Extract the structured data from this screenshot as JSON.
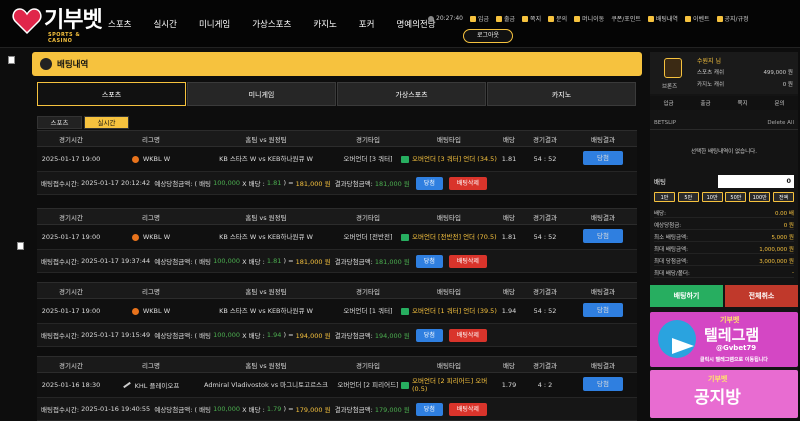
{
  "brand": {
    "name": "기부벳",
    "sub": "SPORTS & CASINO"
  },
  "nav": [
    "스포츠",
    "실시간",
    "미니게임",
    "가상스포츠",
    "카지노",
    "포커",
    "명예의전당"
  ],
  "topright": {
    "time": "20:27:40",
    "items": [
      "입금",
      "출금",
      "쪽지",
      "문의",
      "머니이동",
      "쿠폰/포인트",
      "배팅내역",
      "이벤트",
      "공지/규정"
    ]
  },
  "logout": "로그아웃",
  "page_title": "배팅내역",
  "tabs": [
    "스포츠",
    "미니게임",
    "가상스포츠",
    "카지노"
  ],
  "subtabs": [
    "스포츠",
    "실시간"
  ],
  "headers": [
    "경기시간",
    "리그명",
    "홈팀 vs 원정팀",
    "경기타입",
    "배팅타입",
    "배당",
    "경기결과",
    "배팅결과"
  ],
  "bets": [
    {
      "time": "2025-01-17 19:00",
      "league": "WKBL W",
      "icon": "basketball",
      "home": "KB 스타즈 W",
      "vs": "vs",
      "away": "KEB하나원큐 W",
      "type": "오버언더 [3 쿼터]",
      "pick": "오버언더 [3 쿼터] 언더 (34.5)",
      "odds": "1.81",
      "score": "54 : 52",
      "result": "당첨",
      "s_label": "배팅접수시간:",
      "s_time": "2025-01-17 20:12:42",
      "s_exp": "예상당첨금액: ( 배팅",
      "s_stake": "100,000",
      "s_x": "X 배당 :",
      "s_odds": "1.81",
      "s_eq": ") =",
      "s_win": "181,000 원",
      "s_res_label": "결과당첨금액:",
      "s_res": "181,000 원",
      "btn1": "당첨",
      "btn2": "배팅삭제"
    },
    {
      "time": "2025-01-17 19:00",
      "league": "WKBL W",
      "icon": "basketball",
      "home": "KB 스타즈 W",
      "vs": "vs",
      "away": "KEB하나원큐 W",
      "type": "오버언더 [전반전]",
      "pick": "오버언더 [전반전] 언더 (70.5)",
      "odds": "1.81",
      "score": "54 : 52",
      "result": "당첨",
      "s_label": "배팅접수시간:",
      "s_time": "2025-01-17 19:37:44",
      "s_exp": "예상당첨금액: ( 배팅",
      "s_stake": "100,000",
      "s_x": "X 배당 :",
      "s_odds": "1.81",
      "s_eq": ") =",
      "s_win": "181,000 원",
      "s_res_label": "결과당첨금액:",
      "s_res": "181,000 원",
      "btn1": "당첨",
      "btn2": "배팅삭제"
    },
    {
      "time": "2025-01-17 19:00",
      "league": "WKBL W",
      "icon": "basketball",
      "home": "KB 스타즈 W",
      "vs": "vs",
      "away": "KEB하나원큐 W",
      "type": "오버언더 [1 쿼터]",
      "pick": "오버언더 [1 쿼터] 언더 (39.5)",
      "odds": "1.94",
      "score": "54 : 52",
      "result": "당첨",
      "s_label": "배팅접수시간:",
      "s_time": "2025-01-17 19:15:49",
      "s_exp": "예상당첨금액: ( 배팅",
      "s_stake": "100,000",
      "s_x": "X 배당 :",
      "s_odds": "1.94",
      "s_eq": ") =",
      "s_win": "194,000 원",
      "s_res_label": "결과당첨금액:",
      "s_res": "194,000 원",
      "btn1": "당첨",
      "btn2": "배팅삭제"
    },
    {
      "time": "2025-01-16 18:30",
      "league": "KHL 플레이오프",
      "icon": "hockey",
      "home": "Admiral Vladivostok",
      "vs": "vs",
      "away": "마그니토고르스크",
      "type": "오버언더 [2 피리어드]",
      "pick": "오버언더 [2 피리어드] 오버 (0.5)",
      "odds": "1.79",
      "score": "4 : 2",
      "result": "당첨",
      "s_label": "배팅접수시간:",
      "s_time": "2025-01-16 19:40:55",
      "s_exp": "예상당첨금액: ( 배팅",
      "s_stake": "100,000",
      "s_x": "X 배당 :",
      "s_odds": "1.79",
      "s_eq": ") =",
      "s_win": "179,000 원",
      "s_res_label": "결과당첨금액:",
      "s_res": "179,000 원",
      "btn1": "당첨",
      "btn2": "배팅삭제"
    }
  ],
  "side": {
    "level": "브론즈",
    "username": "수원지 님",
    "sports_money_label": "스포츠 캐쉬",
    "sports_money": "499,000 원",
    "casino_money_label": "카지노 캐쉬",
    "casino_money": "0 원",
    "links": [
      "입금",
      "출금",
      "쪽지",
      "문의"
    ],
    "slip_title": "BETSLIP",
    "slip_clear": "Delete All",
    "slip_empty": "선택한 배팅내역이 없습니다.",
    "bet_label": "배팅",
    "bet_value": "0",
    "amounts": [
      "1만",
      "5만",
      "10만",
      "50만",
      "100만",
      "전액"
    ],
    "info": [
      {
        "k": "배당:",
        "v": "0.00 배"
      },
      {
        "k": "예상당첨금:",
        "v": "0 원"
      },
      {
        "k": "최소 배팅금액:",
        "v": "5,000 원"
      },
      {
        "k": "최대 배팅금액:",
        "v": "1,000,000 원"
      },
      {
        "k": "최대 당첨금액:",
        "v": "3,000,000 원"
      },
      {
        "k": "최대 배당/폴더:",
        "v": "-"
      }
    ],
    "bet_btn": "배팅하기",
    "clear_btn": "전체취소",
    "banner1": {
      "brand": "기부벳",
      "title": "텔레그램",
      "id": "@Gvbet79",
      "note": "클릭시 텔레그램으로 이동됩니다"
    },
    "banner2": {
      "brand": "기부벳",
      "title": "공지방"
    }
  },
  "colors": {
    "accent": "#f6c23e",
    "blue": "#2f7fe0",
    "red": "#d9342b",
    "green": "#27ae60"
  }
}
